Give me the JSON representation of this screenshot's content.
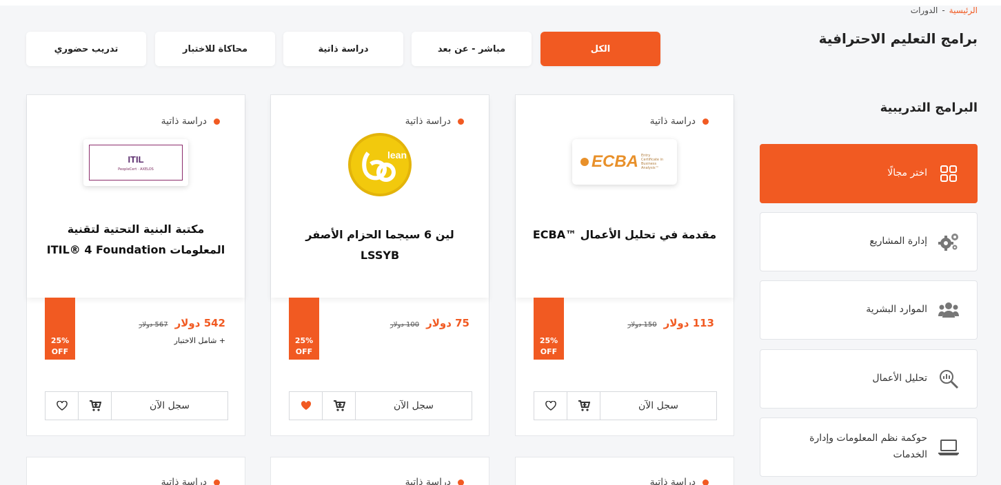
{
  "breadcrumb": {
    "home": "الرئيسية",
    "separator": "-",
    "current": "الدورات"
  },
  "page_title": "برامج التعليم الاحترافية",
  "tabs": [
    {
      "label": "الكل",
      "active": true
    },
    {
      "label": "مباشر - عن بعد",
      "active": false
    },
    {
      "label": "دراسة ذاتية",
      "active": false
    },
    {
      "label": "محاكاة للاختبار",
      "active": false
    },
    {
      "label": "تدريب حضوري",
      "active": false
    }
  ],
  "sidebar": {
    "title": "البرامج التدريبية",
    "items": [
      {
        "label": "اختر مجالًا",
        "icon": "grid-icon",
        "active": true
      },
      {
        "label": "إدارة المشاريع",
        "icon": "gears-icon"
      },
      {
        "label": "الموارد البشرية",
        "icon": "users-icon"
      },
      {
        "label": "تحليل الأعمال",
        "icon": "analytics-search-icon"
      },
      {
        "label": "حوكمة نظم المعلومات وإدارة الخدمات",
        "icon": "laptop-icon"
      }
    ]
  },
  "cards": [
    {
      "type": "دراسة ذاتية",
      "logo_text": "ECBA",
      "logo_sub": "Entry Certificate in Business Analysis™",
      "title": "مقدمة في تحليل الأعمال ™ECBA",
      "price": "113 دولار",
      "old_price": "150 دولار",
      "discount_pct": "25%",
      "discount_off": "OFF",
      "extra": "",
      "favorited": false,
      "register": "سجل الآن"
    },
    {
      "type": "دراسة ذاتية",
      "logo_text": "lean",
      "logo_sub": "",
      "title": "لين 6 سيجما الحزام الأصفر LSSYB",
      "price": "75 دولار",
      "old_price": "100 دولار",
      "discount_pct": "25%",
      "discount_off": "OFF",
      "extra": "",
      "favorited": true,
      "register": "سجل الآن"
    },
    {
      "type": "دراسة ذاتية",
      "logo_text": "ITIL",
      "logo_sub": "PeopleCert · AXELOS",
      "title": "مكتبة البنية التحتية لتقنية المعلومات ITIL® 4 Foundation",
      "price": "542 دولار",
      "old_price": "567 دولار",
      "discount_pct": "25%",
      "discount_off": "OFF",
      "extra": "+ شامل الاختبار",
      "favorited": false,
      "register": "سجل الآن"
    }
  ],
  "lower_cards": [
    {
      "type": "دراسة ذاتية"
    },
    {
      "type": "دراسة ذاتية"
    },
    {
      "type": "دراسة ذاتية"
    }
  ],
  "colors": {
    "accent": "#f15a22",
    "background": "#f5f6f8"
  }
}
